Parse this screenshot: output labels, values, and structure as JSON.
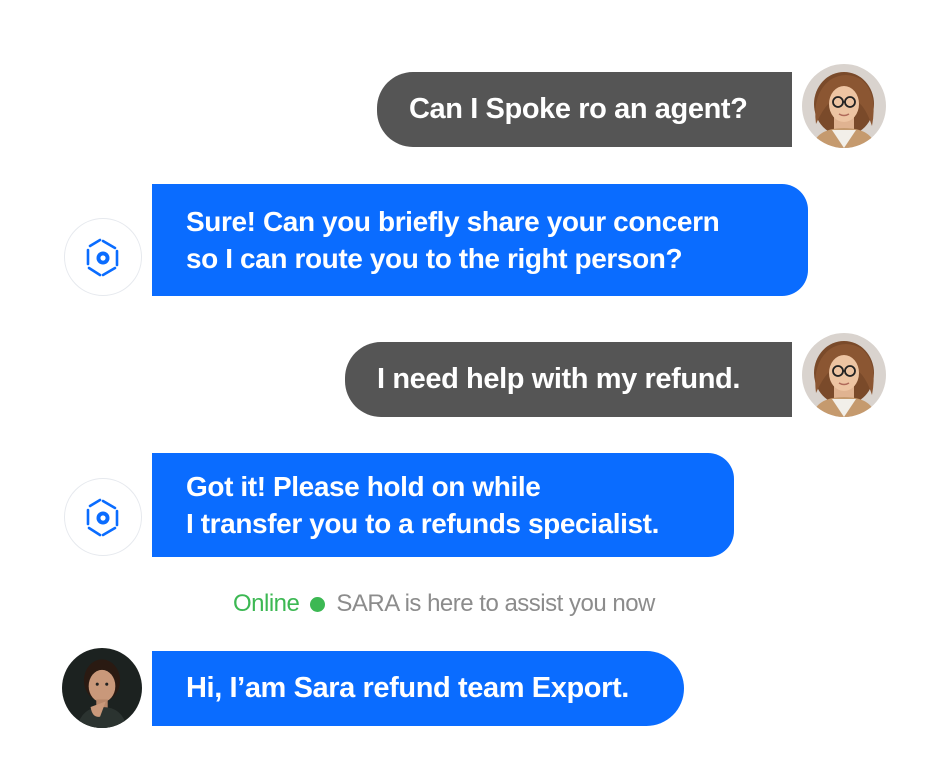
{
  "messages": [
    {
      "sender": "user",
      "text": "Can I Spoke ro an agent?"
    },
    {
      "sender": "bot",
      "lines": [
        "Sure! Can you briefly share your concern",
        "so I can route you to the right person?"
      ]
    },
    {
      "sender": "user",
      "text": "I need help with my refund."
    },
    {
      "sender": "bot",
      "lines": [
        "Got it! Please hold on while",
        "I transfer you to a refunds specialist."
      ]
    },
    {
      "sender": "agent",
      "text": "Hi, I’am Sara refund team Export."
    }
  ],
  "status": {
    "label": "Online",
    "message": "SARA is here to assist you now"
  },
  "colors": {
    "user_bubble": "#555555",
    "bot_bubble": "#0a6cff",
    "online": "#3cb853",
    "status_text": "#8c8c8c"
  },
  "icons": {
    "bot": "aperture-bot-icon",
    "user": "user-avatar",
    "agent": "agent-avatar"
  }
}
